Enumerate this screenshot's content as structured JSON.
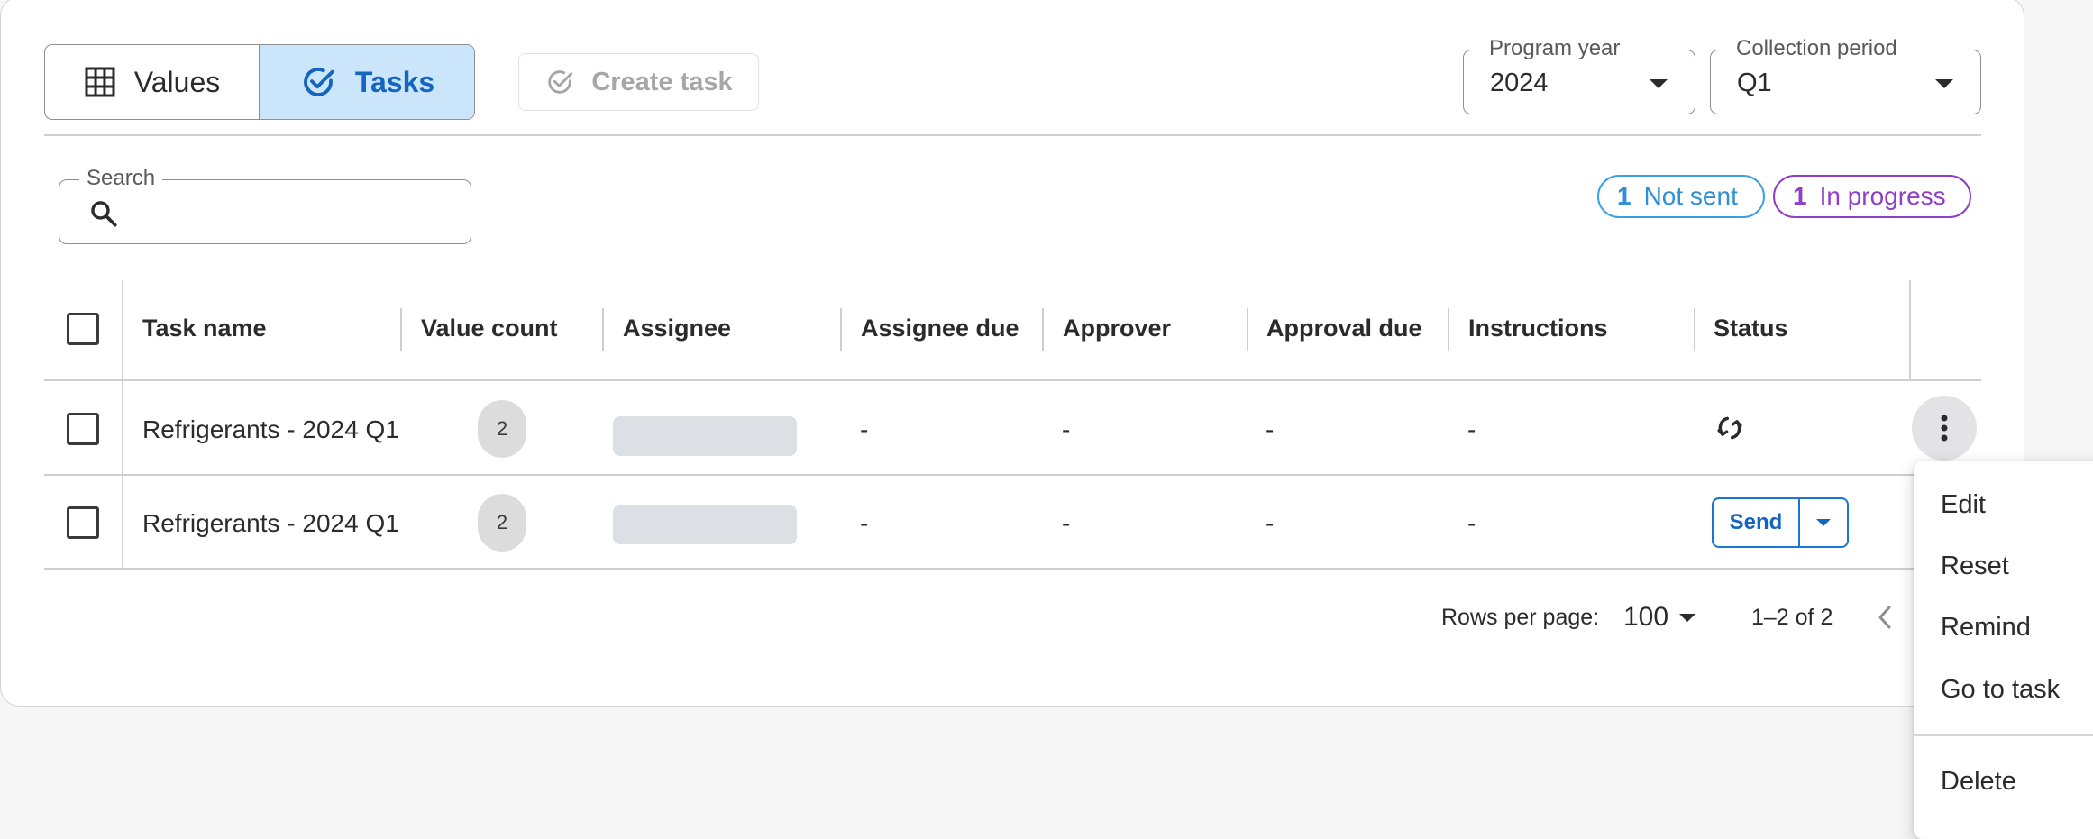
{
  "toolbar": {
    "values_label": "Values",
    "tasks_label": "Tasks",
    "create_task_label": "Create task"
  },
  "filters": {
    "program_year": {
      "label": "Program year",
      "value": "2024"
    },
    "collection_period": {
      "label": "Collection period",
      "value": "Q1"
    }
  },
  "search": {
    "label": "Search",
    "placeholder": ""
  },
  "status_chips": [
    {
      "count": "1",
      "label": "Not sent"
    },
    {
      "count": "1",
      "label": "In progress"
    }
  ],
  "table": {
    "columns": [
      "Task name",
      "Value count",
      "Assignee",
      "Assignee due",
      "Approver",
      "Approval due",
      "Instructions",
      "Status"
    ],
    "rows": [
      {
        "task_name": "Refrigerants - 2024 Q1",
        "value_count": "2",
        "assignee_due": "-",
        "approver": "-",
        "approval_due": "-",
        "instructions": "-",
        "status_icon": "sync-icon"
      },
      {
        "task_name": "Refrigerants - 2024 Q1",
        "value_count": "2",
        "assignee_due": "-",
        "approver": "-",
        "approval_due": "-",
        "instructions": "-",
        "status_button": "Send"
      }
    ]
  },
  "pagination": {
    "rows_per_page_label": "Rows per page:",
    "rows_per_page": "100",
    "range": "1–2 of 2"
  },
  "context_menu": {
    "items": [
      "Edit",
      "Reset",
      "Remind",
      "Go to task"
    ],
    "danger_item": "Delete"
  },
  "colors": {
    "accent": "#1565c0",
    "selected_bg": "#cbe6fb",
    "not_sent": "#2e8fd6",
    "in_progress": "#8e3fc6"
  }
}
